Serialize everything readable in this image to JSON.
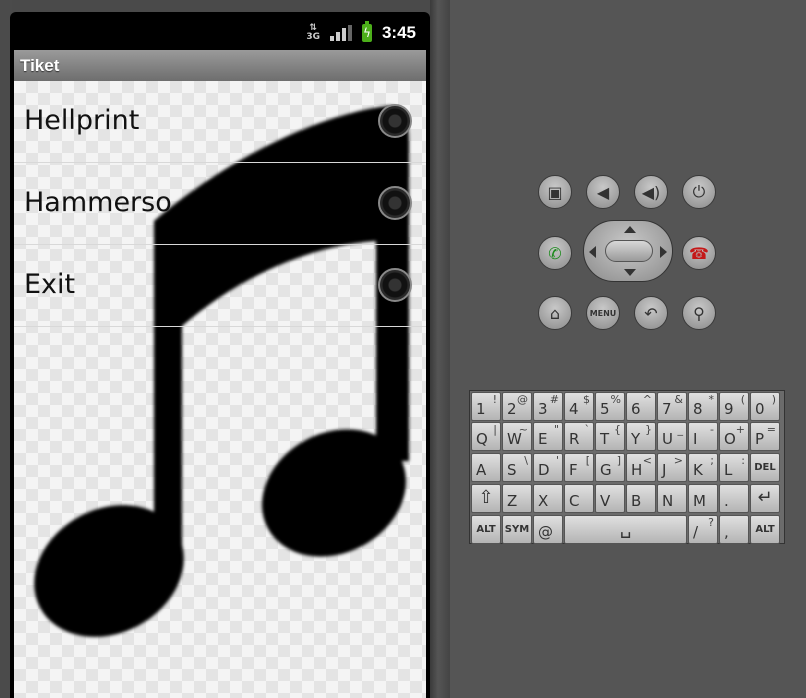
{
  "status_bar": {
    "network": "3G",
    "time": "3:45"
  },
  "app": {
    "title": "Tiket"
  },
  "list": {
    "items": [
      {
        "label": "Hellprint"
      },
      {
        "label": "Hammerso"
      },
      {
        "label": "Exit"
      }
    ]
  },
  "hardware_buttons": {
    "menu_label": "MENU"
  },
  "keyboard": {
    "row1": [
      {
        "main": "1",
        "alt": "!"
      },
      {
        "main": "2",
        "alt": "@"
      },
      {
        "main": "3",
        "alt": "#"
      },
      {
        "main": "4",
        "alt": "$"
      },
      {
        "main": "5",
        "alt": "%"
      },
      {
        "main": "6",
        "alt": "^"
      },
      {
        "main": "7",
        "alt": "&"
      },
      {
        "main": "8",
        "alt": "*"
      },
      {
        "main": "9",
        "alt": "("
      },
      {
        "main": "0",
        "alt": ")"
      }
    ],
    "row2": [
      {
        "main": "Q",
        "alt": "|"
      },
      {
        "main": "W",
        "alt": "~"
      },
      {
        "main": "E",
        "alt": "\""
      },
      {
        "main": "R",
        "alt": "`"
      },
      {
        "main": "T",
        "alt": "{"
      },
      {
        "main": "Y",
        "alt": "}"
      },
      {
        "main": "U",
        "alt": "_"
      },
      {
        "main": "I",
        "alt": "-"
      },
      {
        "main": "O",
        "alt": "+"
      },
      {
        "main": "P",
        "alt": "="
      }
    ],
    "row3": [
      {
        "main": "A",
        "alt": ""
      },
      {
        "main": "S",
        "alt": "\\"
      },
      {
        "main": "D",
        "alt": "'"
      },
      {
        "main": "F",
        "alt": "["
      },
      {
        "main": "G",
        "alt": "]"
      },
      {
        "main": "H",
        "alt": "<"
      },
      {
        "main": "J",
        "alt": ">"
      },
      {
        "main": "K",
        "alt": ";"
      },
      {
        "main": "L",
        "alt": ":"
      }
    ],
    "del_label": "DEL",
    "row4": [
      {
        "main": "Z",
        "alt": ""
      },
      {
        "main": "X",
        "alt": ""
      },
      {
        "main": "C",
        "alt": ""
      },
      {
        "main": "V",
        "alt": ""
      },
      {
        "main": "B",
        "alt": ""
      },
      {
        "main": "N",
        "alt": ""
      },
      {
        "main": "M",
        "alt": ""
      },
      {
        "main": ".",
        "alt": ""
      }
    ],
    "alt_label": "ALT",
    "sym_label": "SYM",
    "at_label": "@",
    "slash_label": "/",
    "question_label": "?",
    "comma_label": ","
  }
}
